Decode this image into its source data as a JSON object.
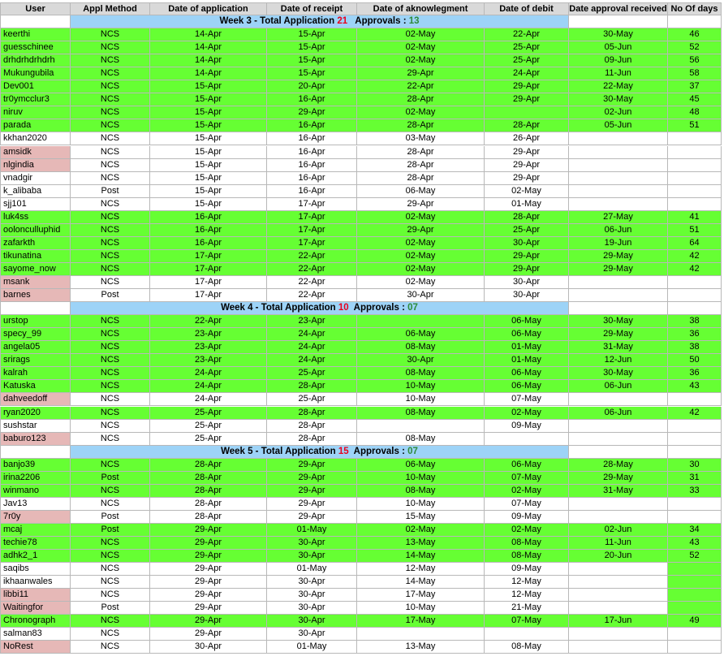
{
  "headers": [
    "User",
    "Appl Method",
    "Date of application",
    "Date of receipt",
    "Date of aknowlegment",
    "Date of debit",
    "Date approval received",
    "No Of days"
  ],
  "colors": {
    "approved": "#66ff33",
    "rejected": "#e6b8b7",
    "week_band": "#9dd3f7",
    "header": "#d9d9d9",
    "applications_count": "#e8001c",
    "approvals_count": "#2e8b3a"
  },
  "sections": [
    {
      "title_prefix": "Week 3 - Total Application ",
      "applications": "21",
      "approvals_label": "   Approvals : ",
      "approvals": "13",
      "rows": [
        {
          "user": "keerthi",
          "method": "NCS",
          "app": "14-Apr",
          "receipt": "15-Apr",
          "ack": "02-May",
          "debit": "22-Apr",
          "approval": "30-May",
          "days": "46",
          "status": "approved"
        },
        {
          "user": "guesschinee",
          "method": "NCS",
          "app": "14-Apr",
          "receipt": "15-Apr",
          "ack": "02-May",
          "debit": "25-Apr",
          "approval": "05-Jun",
          "days": "52",
          "status": "approved"
        },
        {
          "user": "drhdrhdrhdrh",
          "method": "NCS",
          "app": "14-Apr",
          "receipt": "15-Apr",
          "ack": "02-May",
          "debit": "25-Apr",
          "approval": "09-Jun",
          "days": "56",
          "status": "approved"
        },
        {
          "user": "Mukungubila",
          "method": "NCS",
          "app": "14-Apr",
          "receipt": "15-Apr",
          "ack": "29-Apr",
          "debit": "24-Apr",
          "approval": "11-Jun",
          "days": "58",
          "status": "approved"
        },
        {
          "user": "Dev001",
          "method": "NCS",
          "app": "15-Apr",
          "receipt": "20-Apr",
          "ack": "22-Apr",
          "debit": "29-Apr",
          "approval": "22-May",
          "days": "37",
          "status": "approved"
        },
        {
          "user": "tr0ymcclur3",
          "method": "NCS",
          "app": "15-Apr",
          "receipt": "16-Apr",
          "ack": "28-Apr",
          "debit": "29-Apr",
          "approval": "30-May",
          "days": "45",
          "status": "approved"
        },
        {
          "user": "niruv",
          "method": "NCS",
          "app": "15-Apr",
          "receipt": "29-Apr",
          "ack": "02-May",
          "debit": "",
          "approval": "02-Jun",
          "days": "48",
          "status": "approved"
        },
        {
          "user": "parada",
          "method": "NCS",
          "app": "15-Apr",
          "receipt": "16-Apr",
          "ack": "28-Apr",
          "debit": "28-Apr",
          "approval": "05-Jun",
          "days": "51",
          "status": "approved"
        },
        {
          "user": "kkhan2020",
          "method": "NCS",
          "app": "15-Apr",
          "receipt": "16-Apr",
          "ack": "03-May",
          "debit": "26-Apr",
          "approval": "",
          "days": "",
          "status": "pending"
        },
        {
          "user": "amsidk",
          "method": "NCS",
          "app": "15-Apr",
          "receipt": "16-Apr",
          "ack": "28-Apr",
          "debit": "29-Apr",
          "approval": "",
          "days": "",
          "status": "rejected"
        },
        {
          "user": "nlgindia",
          "method": "NCS",
          "app": "15-Apr",
          "receipt": "16-Apr",
          "ack": "28-Apr",
          "debit": "29-Apr",
          "approval": "",
          "days": "",
          "status": "rejected"
        },
        {
          "user": "vnadgir",
          "method": "NCS",
          "app": "15-Apr",
          "receipt": "16-Apr",
          "ack": "28-Apr",
          "debit": "29-Apr",
          "approval": "",
          "days": "",
          "status": "pending"
        },
        {
          "user": "k_alibaba",
          "method": "Post",
          "app": "15-Apr",
          "receipt": "16-Apr",
          "ack": "06-May",
          "debit": "02-May",
          "approval": "",
          "days": "",
          "status": "pending"
        },
        {
          "user": "sjj101",
          "method": "NCS",
          "app": "15-Apr",
          "receipt": "17-Apr",
          "ack": "29-Apr",
          "debit": "01-May",
          "approval": "",
          "days": "",
          "status": "pending"
        },
        {
          "user": "luk4ss",
          "method": "NCS",
          "app": "16-Apr",
          "receipt": "17-Apr",
          "ack": "02-May",
          "debit": "28-Apr",
          "approval": "27-May",
          "days": "41",
          "status": "approved"
        },
        {
          "user": "oolonculluphid",
          "method": "NCS",
          "app": "16-Apr",
          "receipt": "17-Apr",
          "ack": "29-Apr",
          "debit": "25-Apr",
          "approval": "06-Jun",
          "days": "51",
          "status": "approved"
        },
        {
          "user": "zafarkth",
          "method": "NCS",
          "app": "16-Apr",
          "receipt": "17-Apr",
          "ack": "02-May",
          "debit": "30-Apr",
          "approval": "19-Jun",
          "days": "64",
          "status": "approved"
        },
        {
          "user": "tikunatina",
          "method": "NCS",
          "app": "17-Apr",
          "receipt": "22-Apr",
          "ack": "02-May",
          "debit": "29-Apr",
          "approval": "29-May",
          "days": "42",
          "status": "approved"
        },
        {
          "user": "sayome_now",
          "method": "NCS",
          "app": "17-Apr",
          "receipt": "22-Apr",
          "ack": "02-May",
          "debit": "29-Apr",
          "approval": "29-May",
          "days": "42",
          "status": "approved"
        },
        {
          "user": "msank",
          "method": "NCS",
          "app": "17-Apr",
          "receipt": "22-Apr",
          "ack": "02-May",
          "debit": "30-Apr",
          "approval": "",
          "days": "",
          "status": "rejected"
        },
        {
          "user": "barnes",
          "method": "Post",
          "app": "17-Apr",
          "receipt": "22-Apr",
          "ack": "30-Apr",
          "debit": "30-Apr",
          "approval": "",
          "days": "",
          "status": "rejected"
        }
      ]
    },
    {
      "title_prefix": "Week 4 - Total Application ",
      "applications": "10",
      "approvals_label": "  Approvals : ",
      "approvals": "07",
      "rows": [
        {
          "user": "urstop",
          "method": "NCS",
          "app": "22-Apr",
          "receipt": "23-Apr",
          "ack": "",
          "debit": "06-May",
          "approval": "30-May",
          "days": "38",
          "status": "approved"
        },
        {
          "user": "specy_99",
          "method": "NCS",
          "app": "23-Apr",
          "receipt": "24-Apr",
          "ack": "06-May",
          "debit": "06-May",
          "approval": "29-May",
          "days": "36",
          "status": "approved"
        },
        {
          "user": "angela05",
          "method": "NCS",
          "app": "23-Apr",
          "receipt": "24-Apr",
          "ack": "08-May",
          "debit": "01-May",
          "approval": "31-May",
          "days": "38",
          "status": "approved"
        },
        {
          "user": "srirags",
          "method": "NCS",
          "app": "23-Apr",
          "receipt": "24-Apr",
          "ack": "30-Apr",
          "debit": "01-May",
          "approval": "12-Jun",
          "days": "50",
          "status": "approved"
        },
        {
          "user": "kalrah",
          "method": "NCS",
          "app": "24-Apr",
          "receipt": "25-Apr",
          "ack": "08-May",
          "debit": "06-May",
          "approval": "30-May",
          "days": "36",
          "status": "approved"
        },
        {
          "user": "Katuska",
          "method": "NCS",
          "app": "24-Apr",
          "receipt": "28-Apr",
          "ack": "10-May",
          "debit": "06-May",
          "approval": "06-Jun",
          "days": "43",
          "status": "approved"
        },
        {
          "user": "dahveedoff",
          "method": "NCS",
          "app": "24-Apr",
          "receipt": "25-Apr",
          "ack": "10-May",
          "debit": "07-May",
          "approval": "",
          "days": "",
          "status": "rejected"
        },
        {
          "user": "ryan2020",
          "method": "NCS",
          "app": "25-Apr",
          "receipt": "28-Apr",
          "ack": "08-May",
          "debit": "02-May",
          "approval": "06-Jun",
          "days": "42",
          "status": "approved"
        },
        {
          "user": "sushstar",
          "method": "NCS",
          "app": "25-Apr",
          "receipt": "28-Apr",
          "ack": "",
          "debit": "09-May",
          "approval": "",
          "days": "",
          "status": "pending"
        },
        {
          "user": "baburo123",
          "method": "NCS",
          "app": "25-Apr",
          "receipt": "28-Apr",
          "ack": "08-May",
          "debit": "",
          "approval": "",
          "days": "",
          "status": "rejected"
        }
      ]
    },
    {
      "title_prefix": "Week 5 -  Total Application ",
      "applications": "15",
      "approvals_label": "  Approvals : ",
      "approvals": "07",
      "rows": [
        {
          "user": "banjo39",
          "method": "NCS",
          "app": "28-Apr",
          "receipt": "29-Apr",
          "ack": "06-May",
          "debit": "06-May",
          "approval": "28-May",
          "days": "30",
          "status": "approved"
        },
        {
          "user": "irina2206",
          "method": "Post",
          "app": "28-Apr",
          "receipt": "29-Apr",
          "ack": "10-May",
          "debit": "07-May",
          "approval": "29-May",
          "days": "31",
          "status": "approved"
        },
        {
          "user": "winmano",
          "method": "NCS",
          "app": "28-Apr",
          "receipt": "29-Apr",
          "ack": "08-May",
          "debit": "02-May",
          "approval": "31-May",
          "days": "33",
          "status": "approved"
        },
        {
          "user": "Jav13",
          "method": "NCS",
          "app": "28-Apr",
          "receipt": "29-Apr",
          "ack": "10-May",
          "debit": "07-May",
          "approval": "",
          "days": "",
          "status": "pending"
        },
        {
          "user": "7r0y",
          "method": "Post",
          "app": "28-Apr",
          "receipt": "29-Apr",
          "ack": "15-May",
          "debit": "09-May",
          "approval": "",
          "days": "",
          "status": "rejected"
        },
        {
          "user": "mcaj",
          "method": "Post",
          "app": "29-Apr",
          "receipt": "01-May",
          "ack": "02-May",
          "debit": "02-May",
          "approval": "02-Jun",
          "days": "34",
          "status": "approved"
        },
        {
          "user": "techie78",
          "method": "NCS",
          "app": "29-Apr",
          "receipt": "30-Apr",
          "ack": "13-May",
          "debit": "08-May",
          "approval": "11-Jun",
          "days": "43",
          "status": "approved"
        },
        {
          "user": "adhk2_1",
          "method": "NCS",
          "app": "29-Apr",
          "receipt": "30-Apr",
          "ack": "14-May",
          "debit": "08-May",
          "approval": "20-Jun",
          "days": "52",
          "status": "approved"
        },
        {
          "user": "saqibs",
          "method": "NCS",
          "app": "29-Apr",
          "receipt": "01-May",
          "ack": "12-May",
          "debit": "09-May",
          "approval": "",
          "days": "",
          "status": "pending",
          "days_green": true
        },
        {
          "user": "ikhaanwales",
          "method": "NCS",
          "app": "29-Apr",
          "receipt": "30-Apr",
          "ack": "14-May",
          "debit": "12-May",
          "approval": "",
          "days": "",
          "status": "pending",
          "days_green": true
        },
        {
          "user": "libbi11",
          "method": "NCS",
          "app": "29-Apr",
          "receipt": "30-Apr",
          "ack": "17-May",
          "debit": "12-May",
          "approval": "",
          "days": "",
          "status": "rejected",
          "days_green": true
        },
        {
          "user": "Waitingfor",
          "method": "Post",
          "app": "29-Apr",
          "receipt": "30-Apr",
          "ack": "10-May",
          "debit": "21-May",
          "approval": "",
          "days": "",
          "status": "rejected",
          "days_green": true
        },
        {
          "user": "Chronograph",
          "method": "NCS",
          "app": "29-Apr",
          "receipt": "30-Apr",
          "ack": "17-May",
          "debit": "07-May",
          "approval": "17-Jun",
          "days": "49",
          "status": "approved"
        },
        {
          "user": "salman83",
          "method": "NCS",
          "app": "29-Apr",
          "receipt": "30-Apr",
          "ack": "",
          "debit": "",
          "approval": "",
          "days": "",
          "status": "pending"
        },
        {
          "user": "NoRest",
          "method": "NCS",
          "app": "30-Apr",
          "receipt": "01-May",
          "ack": "13-May",
          "debit": "08-May",
          "approval": "",
          "days": "",
          "status": "rejected"
        }
      ]
    }
  ]
}
